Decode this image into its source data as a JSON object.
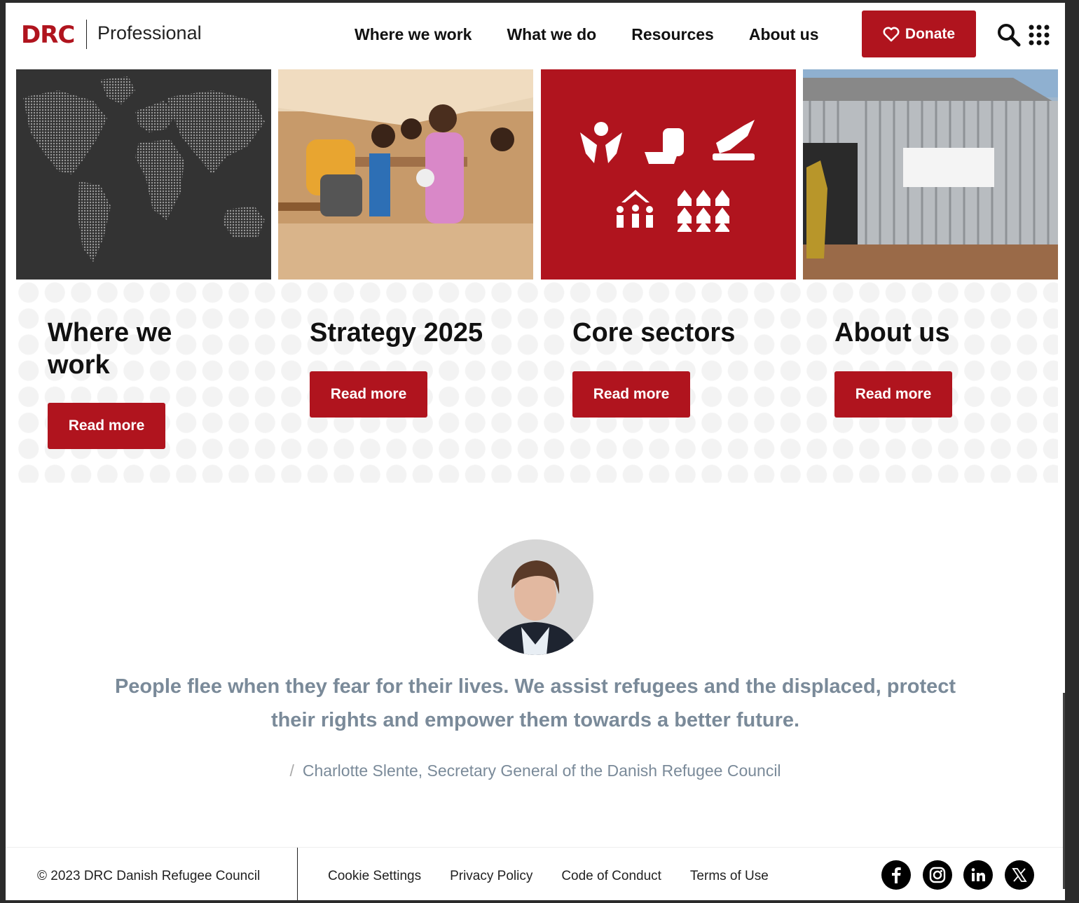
{
  "header": {
    "logo": "DRC",
    "logo_sub": "Professional",
    "nav": [
      "Where we work",
      "What we do",
      "Resources",
      "About us"
    ],
    "donate_label": "Donate"
  },
  "cards": [
    {
      "title": "Where we work",
      "button": "Read more",
      "image": "world-map-dots"
    },
    {
      "title": "Strategy 2025",
      "button": "Read more",
      "image": "children-classroom-photo"
    },
    {
      "title": "Core sectors",
      "button": "Read more",
      "image": "sector-icons"
    },
    {
      "title": "About us",
      "button": "Read more",
      "image": "corrugated-shelter-photo"
    }
  ],
  "quote": {
    "text": "People flee when they fear for their lives. We assist refugees and the displaced, protect their rights and empower them towards a better future.",
    "attribution": "Charlotte Slente, Secretary General of the Danish Refugee Council"
  },
  "footer": {
    "copyright": "© 2023 DRC Danish Refugee Council",
    "links": [
      "Cookie Settings",
      "Privacy Policy",
      "Code of Conduct",
      "Terms of Use"
    ],
    "social": [
      "facebook-icon",
      "instagram-icon",
      "linkedin-icon",
      "x-icon"
    ]
  },
  "colors": {
    "brand_red": "#b0141e",
    "quote_gray": "#7a8a99",
    "map_bg": "#333333"
  }
}
